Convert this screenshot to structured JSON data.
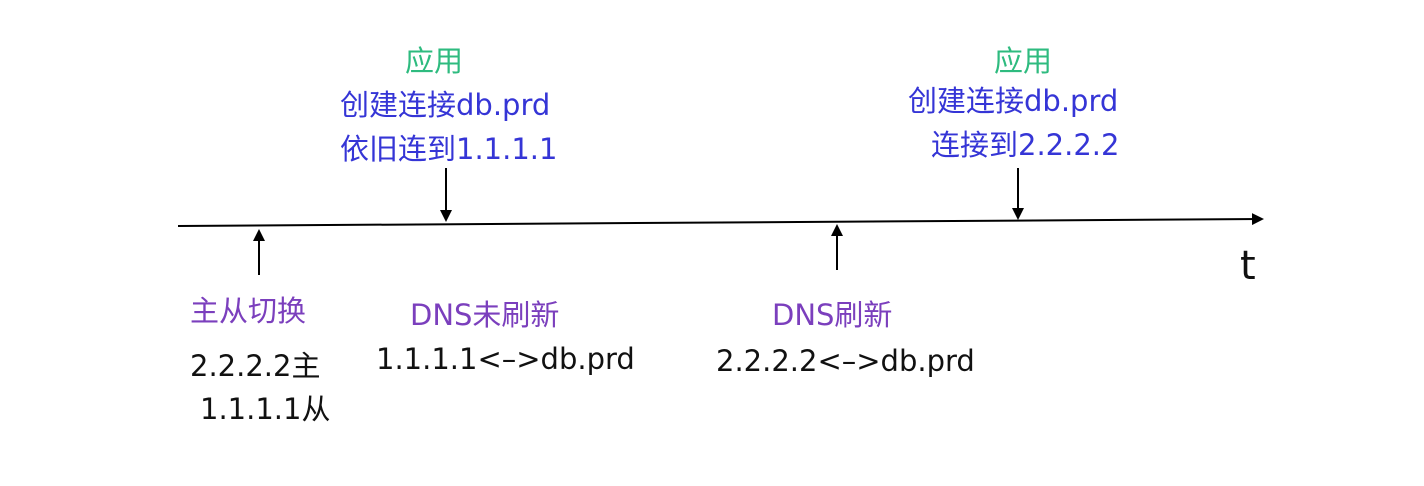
{
  "axis": {
    "label": "t"
  },
  "events_above": [
    {
      "actor": "应用",
      "line1": "创建连接db.prd",
      "line2": "依旧连到1.1.1.1"
    },
    {
      "actor": "应用",
      "line1": "创建连接db.prd",
      "line2": "连接到2.2.2.2"
    }
  ],
  "events_below": [
    {
      "title": "主从切换",
      "line1": "2.2.2.2主",
      "line2": "1.1.1.1从"
    },
    {
      "title": "DNS未刷新",
      "line1": "1.1.1.1<–>db.prd"
    },
    {
      "title": "DNS刷新",
      "line1": "2.2.2.2<–>db.prd"
    }
  ],
  "colors": {
    "actor": "#2ebb7f",
    "app_text": "#3535d6",
    "event_title": "#7b3fbd",
    "detail_text": "#111111",
    "line": "#000000"
  }
}
